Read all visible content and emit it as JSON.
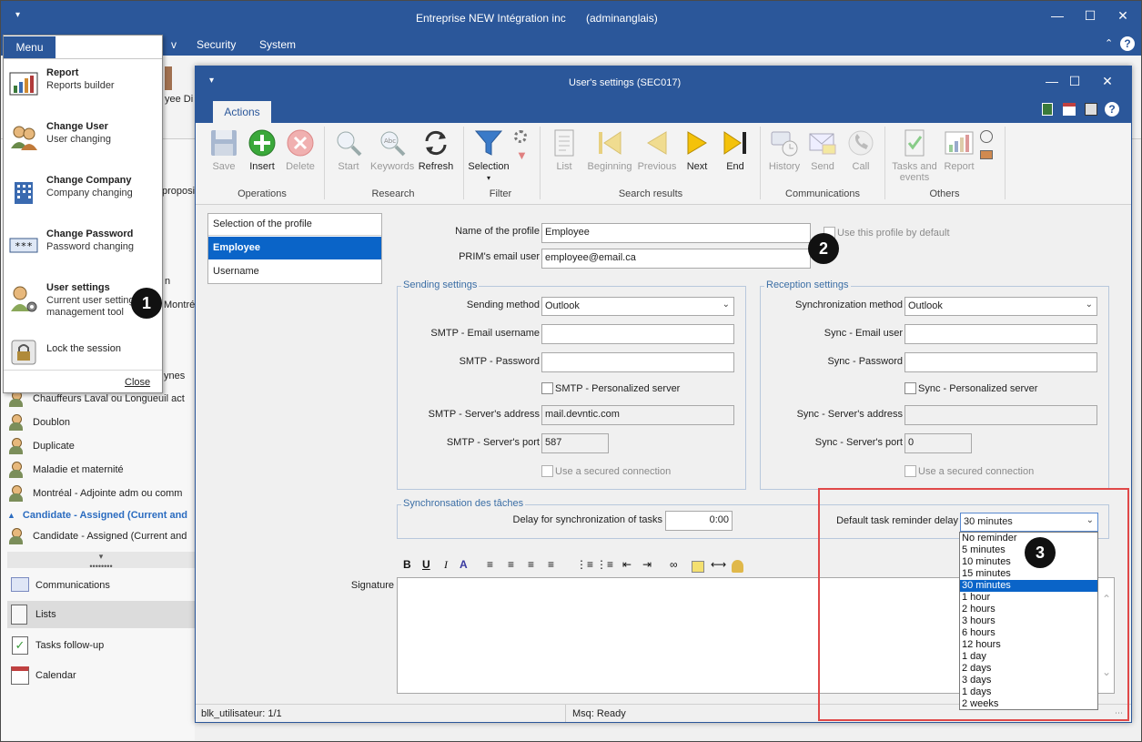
{
  "app": {
    "title": "Entreprise NEW Intégration inc",
    "user": "(adminanglais)",
    "menubar": [
      "v",
      "Security",
      "System"
    ]
  },
  "menu_popup": {
    "tab_label": "Menu",
    "items": [
      {
        "title": "Report",
        "subtitle": "Reports builder",
        "icon": "bar-chart-icon"
      },
      {
        "title": "Change User",
        "subtitle": "User changing",
        "icon": "users-icon"
      },
      {
        "title": "Change Company",
        "subtitle": "Company changing",
        "icon": "building-icon"
      },
      {
        "title": "Change Password",
        "subtitle": "Password changing",
        "icon": "password-icon"
      },
      {
        "title": "User settings",
        "subtitle": "Current user settings management tool",
        "icon": "user-gear-icon"
      },
      {
        "title": "Lock the session",
        "subtitle": "",
        "icon": "lock-icon"
      }
    ],
    "close_label": "Close"
  },
  "background": {
    "ribbon_fragment": "yee Di",
    "list_fragments": [
      "proposit",
      "n",
      "Montré",
      "ynes"
    ],
    "list_items": [
      "Chauffeurs Laval ou Longueuil act",
      "Doublon",
      "Duplicate",
      "Maladie et maternité",
      "Montréal - Adjointe adm ou comm",
      "Candidate - Assigned (Current and",
      "Candidate - Assigned (Current and"
    ],
    "nav_items": [
      "Communications",
      "Lists",
      "Tasks follow-up",
      "Calendar"
    ]
  },
  "dialog": {
    "title": "User's settings (SEC017)",
    "tab": "Actions",
    "ribbon": {
      "operations": {
        "label": "Operations",
        "buttons": [
          "Save",
          "Insert",
          "Delete"
        ]
      },
      "research": {
        "label": "Research",
        "buttons": [
          "Start",
          "Keywords",
          "Refresh"
        ]
      },
      "filter": {
        "label": "Filter",
        "buttons": [
          "Selection"
        ]
      },
      "search_results": {
        "label": "Search results",
        "buttons": [
          "List",
          "Beginning",
          "Previous",
          "Next",
          "End"
        ]
      },
      "communications": {
        "label": "Communications",
        "buttons": [
          "History",
          "Send",
          "Call"
        ]
      },
      "others": {
        "label": "Others",
        "buttons": [
          "Tasks and events",
          "Report"
        ]
      }
    },
    "profiles": {
      "header": "Selection of the profile",
      "items": [
        "Employee",
        "Username"
      ],
      "selected": "Employee"
    },
    "profile_name_label": "Name of the profile",
    "profile_name_value": "Employee",
    "default_profile_label": "Use this profile by default",
    "prim_email_label": "PRIM's email user",
    "prim_email_value": "employee@email.ca",
    "sending": {
      "title": "Sending settings",
      "method_label": "Sending method",
      "method_value": "Outlook",
      "username_label": "SMTP - Email username",
      "username_value": "",
      "password_label": "SMTP - Password",
      "password_value": "",
      "personalized_label": "SMTP - Personalized server",
      "address_label": "SMTP - Server's address",
      "address_value": "mail.devntic.com",
      "port_label": "SMTP - Server's port",
      "port_value": "587",
      "secured_label": "Use a secured connection"
    },
    "reception": {
      "title": "Reception settings",
      "method_label": "Synchronization method",
      "method_value": "Outlook",
      "user_label": "Sync - Email user",
      "user_value": "",
      "password_label": "Sync - Password",
      "password_value": "",
      "personalized_label": "Sync - Personalized server",
      "address_label": "Sync - Server's address",
      "address_value": "",
      "port_label": "Sync - Server's port",
      "port_value": "0",
      "secured_label": "Use a secured connection"
    },
    "tasks": {
      "title": "Synchronsation des tâches",
      "delay_label": "Delay for synchronization of tasks",
      "delay_value": "0:00",
      "reminder_label": "Default task reminder delay",
      "reminder_value": "30 minutes",
      "reminder_options": [
        "No reminder",
        "5 minutes",
        "10 minutes",
        "15 minutes",
        "30 minutes",
        "1 hour",
        "2 hours",
        "3 hours",
        "6 hours",
        "12 hours",
        "1 day",
        "2 days",
        "3 days",
        "1 days",
        "2 weeks"
      ],
      "reminder_selected_index": 4
    },
    "signature_label": "Signature",
    "status": {
      "left": "blk_utilisateur: 1/1",
      "right": "Msq: Ready"
    }
  },
  "callouts": [
    "1",
    "2",
    "3"
  ],
  "colors": {
    "titlebar": "#2b579a",
    "selection": "#0a64c8",
    "highlight_box": "#e04848"
  }
}
